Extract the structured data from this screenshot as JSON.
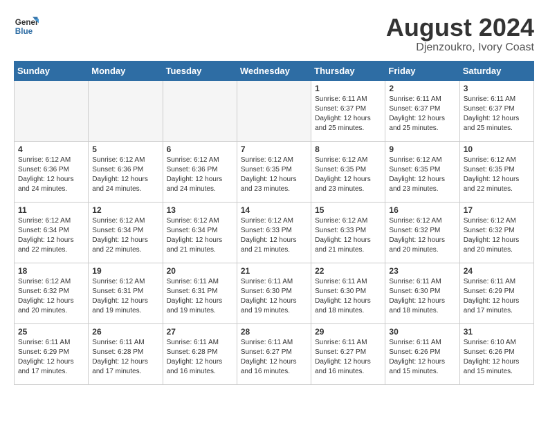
{
  "header": {
    "logo_line1": "General",
    "logo_line2": "Blue",
    "month_year": "August 2024",
    "location": "Djenzoukro, Ivory Coast"
  },
  "days_of_week": [
    "Sunday",
    "Monday",
    "Tuesday",
    "Wednesday",
    "Thursday",
    "Friday",
    "Saturday"
  ],
  "weeks": [
    [
      {
        "day": "",
        "info": ""
      },
      {
        "day": "",
        "info": ""
      },
      {
        "day": "",
        "info": ""
      },
      {
        "day": "",
        "info": ""
      },
      {
        "day": "1",
        "info": "Sunrise: 6:11 AM\nSunset: 6:37 PM\nDaylight: 12 hours\nand 25 minutes."
      },
      {
        "day": "2",
        "info": "Sunrise: 6:11 AM\nSunset: 6:37 PM\nDaylight: 12 hours\nand 25 minutes."
      },
      {
        "day": "3",
        "info": "Sunrise: 6:11 AM\nSunset: 6:37 PM\nDaylight: 12 hours\nand 25 minutes."
      }
    ],
    [
      {
        "day": "4",
        "info": "Sunrise: 6:12 AM\nSunset: 6:36 PM\nDaylight: 12 hours\nand 24 minutes."
      },
      {
        "day": "5",
        "info": "Sunrise: 6:12 AM\nSunset: 6:36 PM\nDaylight: 12 hours\nand 24 minutes."
      },
      {
        "day": "6",
        "info": "Sunrise: 6:12 AM\nSunset: 6:36 PM\nDaylight: 12 hours\nand 24 minutes."
      },
      {
        "day": "7",
        "info": "Sunrise: 6:12 AM\nSunset: 6:35 PM\nDaylight: 12 hours\nand 23 minutes."
      },
      {
        "day": "8",
        "info": "Sunrise: 6:12 AM\nSunset: 6:35 PM\nDaylight: 12 hours\nand 23 minutes."
      },
      {
        "day": "9",
        "info": "Sunrise: 6:12 AM\nSunset: 6:35 PM\nDaylight: 12 hours\nand 23 minutes."
      },
      {
        "day": "10",
        "info": "Sunrise: 6:12 AM\nSunset: 6:35 PM\nDaylight: 12 hours\nand 22 minutes."
      }
    ],
    [
      {
        "day": "11",
        "info": "Sunrise: 6:12 AM\nSunset: 6:34 PM\nDaylight: 12 hours\nand 22 minutes."
      },
      {
        "day": "12",
        "info": "Sunrise: 6:12 AM\nSunset: 6:34 PM\nDaylight: 12 hours\nand 22 minutes."
      },
      {
        "day": "13",
        "info": "Sunrise: 6:12 AM\nSunset: 6:34 PM\nDaylight: 12 hours\nand 21 minutes."
      },
      {
        "day": "14",
        "info": "Sunrise: 6:12 AM\nSunset: 6:33 PM\nDaylight: 12 hours\nand 21 minutes."
      },
      {
        "day": "15",
        "info": "Sunrise: 6:12 AM\nSunset: 6:33 PM\nDaylight: 12 hours\nand 21 minutes."
      },
      {
        "day": "16",
        "info": "Sunrise: 6:12 AM\nSunset: 6:32 PM\nDaylight: 12 hours\nand 20 minutes."
      },
      {
        "day": "17",
        "info": "Sunrise: 6:12 AM\nSunset: 6:32 PM\nDaylight: 12 hours\nand 20 minutes."
      }
    ],
    [
      {
        "day": "18",
        "info": "Sunrise: 6:12 AM\nSunset: 6:32 PM\nDaylight: 12 hours\nand 20 minutes."
      },
      {
        "day": "19",
        "info": "Sunrise: 6:12 AM\nSunset: 6:31 PM\nDaylight: 12 hours\nand 19 minutes."
      },
      {
        "day": "20",
        "info": "Sunrise: 6:11 AM\nSunset: 6:31 PM\nDaylight: 12 hours\nand 19 minutes."
      },
      {
        "day": "21",
        "info": "Sunrise: 6:11 AM\nSunset: 6:30 PM\nDaylight: 12 hours\nand 19 minutes."
      },
      {
        "day": "22",
        "info": "Sunrise: 6:11 AM\nSunset: 6:30 PM\nDaylight: 12 hours\nand 18 minutes."
      },
      {
        "day": "23",
        "info": "Sunrise: 6:11 AM\nSunset: 6:30 PM\nDaylight: 12 hours\nand 18 minutes."
      },
      {
        "day": "24",
        "info": "Sunrise: 6:11 AM\nSunset: 6:29 PM\nDaylight: 12 hours\nand 17 minutes."
      }
    ],
    [
      {
        "day": "25",
        "info": "Sunrise: 6:11 AM\nSunset: 6:29 PM\nDaylight: 12 hours\nand 17 minutes."
      },
      {
        "day": "26",
        "info": "Sunrise: 6:11 AM\nSunset: 6:28 PM\nDaylight: 12 hours\nand 17 minutes."
      },
      {
        "day": "27",
        "info": "Sunrise: 6:11 AM\nSunset: 6:28 PM\nDaylight: 12 hours\nand 16 minutes."
      },
      {
        "day": "28",
        "info": "Sunrise: 6:11 AM\nSunset: 6:27 PM\nDaylight: 12 hours\nand 16 minutes."
      },
      {
        "day": "29",
        "info": "Sunrise: 6:11 AM\nSunset: 6:27 PM\nDaylight: 12 hours\nand 16 minutes."
      },
      {
        "day": "30",
        "info": "Sunrise: 6:11 AM\nSunset: 6:26 PM\nDaylight: 12 hours\nand 15 minutes."
      },
      {
        "day": "31",
        "info": "Sunrise: 6:10 AM\nSunset: 6:26 PM\nDaylight: 12 hours\nand 15 minutes."
      }
    ]
  ]
}
